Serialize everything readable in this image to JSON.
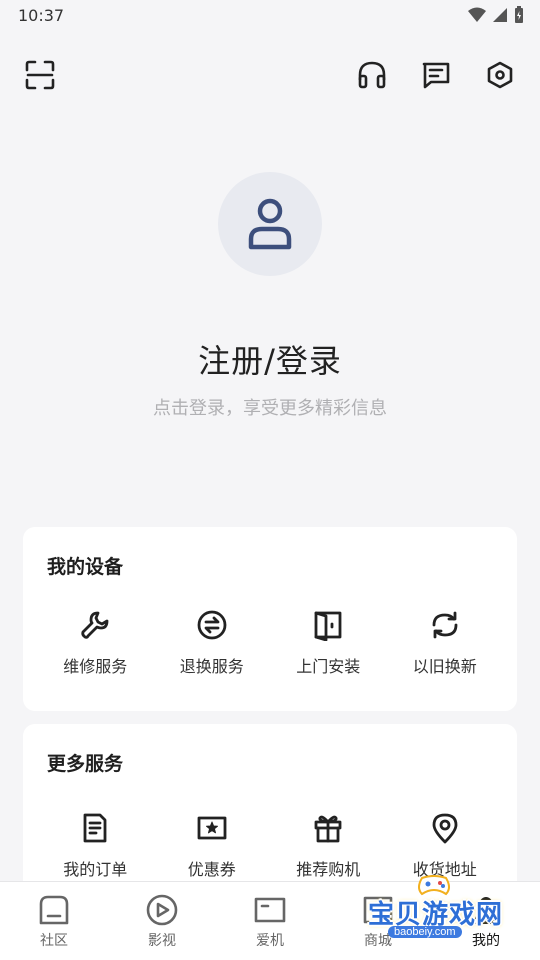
{
  "status_bar": {
    "time": "10:37"
  },
  "profile": {
    "title": "注册/登录",
    "subtitle": "点击登录，享受更多精彩信息"
  },
  "devices": {
    "title": "我的设备",
    "items": [
      {
        "label": "维修服务",
        "icon": "wrench-icon"
      },
      {
        "label": "退换服务",
        "icon": "exchange-icon"
      },
      {
        "label": "上门安装",
        "icon": "door-icon"
      },
      {
        "label": "以旧换新",
        "icon": "refresh-icon"
      }
    ]
  },
  "services": {
    "title": "更多服务",
    "items": [
      {
        "label": "我的订单",
        "icon": "order-icon"
      },
      {
        "label": "优惠券",
        "icon": "coupon-icon"
      },
      {
        "label": "推荐购机",
        "icon": "gift-icon"
      },
      {
        "label": "收货地址",
        "icon": "location-icon"
      }
    ]
  },
  "nav": {
    "items": [
      {
        "label": "社区",
        "icon": "community-icon"
      },
      {
        "label": "影视",
        "icon": "play-icon"
      },
      {
        "label": "爱机",
        "icon": "device-icon"
      },
      {
        "label": "商城",
        "icon": "shop-icon"
      },
      {
        "label": "我的",
        "icon": "profile-icon"
      }
    ],
    "active": "我的"
  },
  "watermark": {
    "text": "宝贝游戏网",
    "url": "baobeiy.com"
  },
  "colors": {
    "accent": "#3d4f7c",
    "background": "#f5f5f7",
    "card": "#ffffff"
  }
}
